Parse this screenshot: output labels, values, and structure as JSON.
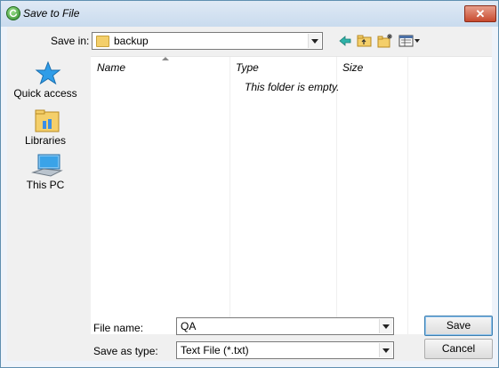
{
  "window": {
    "title": "Save to File",
    "close_label": "✕"
  },
  "toolbar": {
    "save_in_label": "Save in:",
    "save_in_value": "backup"
  },
  "places": [
    {
      "label": "Quick access",
      "icon": "star-icon"
    },
    {
      "label": "Libraries",
      "icon": "libraries-icon"
    },
    {
      "label": "This PC",
      "icon": "computer-icon"
    }
  ],
  "file_list": {
    "columns": [
      "Name",
      "Type",
      "Size"
    ],
    "empty_message": "This folder is empty."
  },
  "form": {
    "file_name_label": "File name:",
    "file_name_value": "QA",
    "save_as_type_label": "Save as type:",
    "save_as_type_value": "Text File (*.txt)"
  },
  "buttons": {
    "save": "Save",
    "cancel": "Cancel"
  },
  "colors": {
    "accent": "#3c7fb1",
    "folder": "#f4cf6a"
  }
}
